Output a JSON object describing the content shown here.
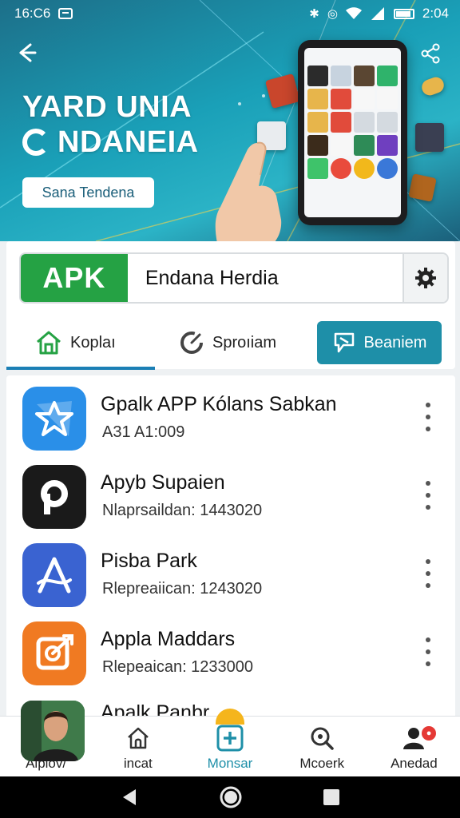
{
  "status_bar": {
    "time_left": "16:C6",
    "time_right": "2:04"
  },
  "hero": {
    "title_line1": "YARD UNIA",
    "title_line2": "NDANEIA",
    "cta_label": "Sana Tendena"
  },
  "search": {
    "badge": "APK",
    "value": "Endana Herdia"
  },
  "tabs": [
    {
      "label": "Koplaı"
    },
    {
      "label": "Sproıiam"
    },
    {
      "label": "Beaniem"
    }
  ],
  "apps": [
    {
      "name": "Gpalk APP Kólans Sabkan",
      "meta": "A31 A1:009",
      "color": "#2a8fe8",
      "icon": "star-icon"
    },
    {
      "name": "Apyb Supaien",
      "meta": "Nlaprsaildan: 1443020",
      "color": "#1a1a1a",
      "icon": "p-icon"
    },
    {
      "name": "Pisba Park",
      "meta": "Rlepreaiican: 1243020",
      "color": "#3a63d1",
      "icon": "a-icon"
    },
    {
      "name": "Appla Maddars",
      "meta": "Rlepeaican: 1233000",
      "color": "#f07a22",
      "icon": "target-icon"
    },
    {
      "name": "Apalk Panbr",
      "meta": "",
      "color": "#2b6b3a",
      "icon": "photo-icon"
    }
  ],
  "bottom_nav": [
    {
      "label": "Alpiov/",
      "icon": "avatar"
    },
    {
      "label": "incat",
      "icon": "home-icon"
    },
    {
      "label": "Monsar",
      "icon": "add-icon",
      "active": true
    },
    {
      "label": "Mcoerk",
      "icon": "search-icon"
    },
    {
      "label": "Anedad",
      "icon": "profile-icon"
    }
  ],
  "colors": {
    "accent": "#1e8fa8",
    "apk_green": "#25a244",
    "hero_start": "#1c6f89",
    "badge_red": "#e53935"
  }
}
